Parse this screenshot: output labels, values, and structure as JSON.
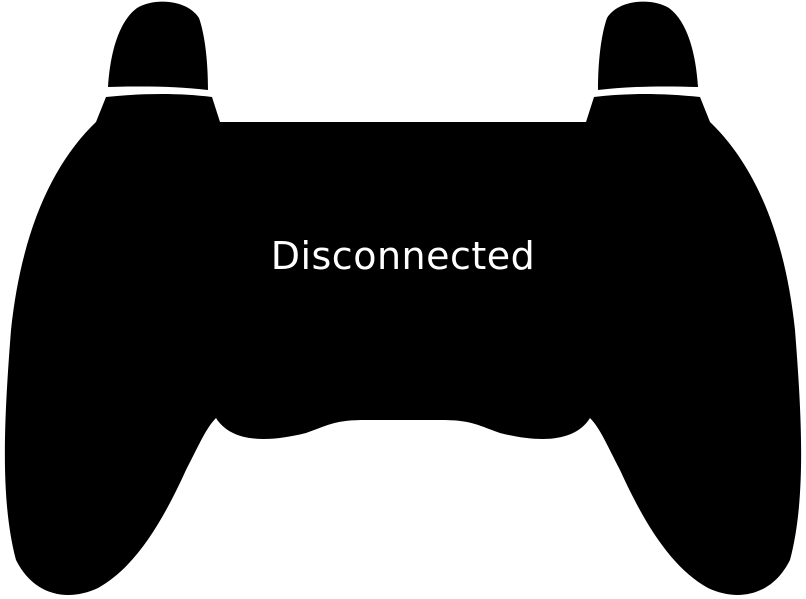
{
  "status": {
    "label": "Disconnected"
  },
  "icon": {
    "name": "gamepad-icon",
    "fill_color": "#000000",
    "text_color": "#ffffff",
    "background_color": "#ffffff"
  }
}
